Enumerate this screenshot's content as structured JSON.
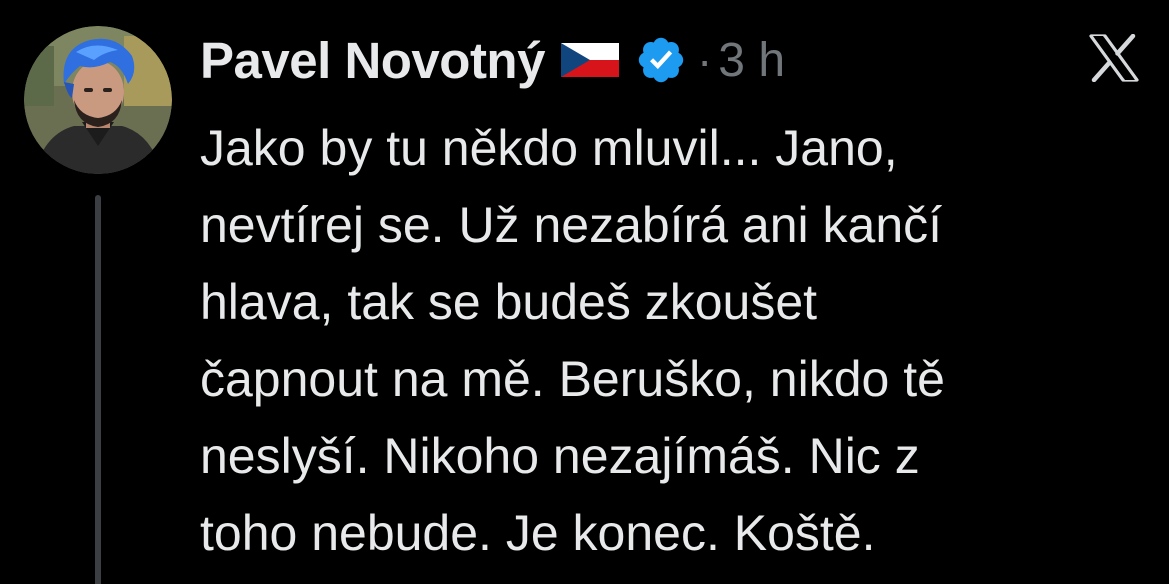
{
  "tweet": {
    "author": {
      "display_name": "Pavel Novotný",
      "flag_icon": "czech-flag-icon",
      "verified_icon": "verified-badge-icon",
      "verified_color": "#1d9bf0"
    },
    "separator": "·",
    "time": "3 h",
    "platform_icon": "x-logo-icon",
    "text_lines": [
      "Jako by tu někdo mluvil... Jano,",
      "nevtírej se. Už nezabírá ani kančí",
      "hlava, tak se budeš zkoušet",
      "čapnout na mě. Beruško, nikdo tě",
      "neslyší. Nikoho nezajímáš. Nic z",
      "toho nebude. Je konec. Koště."
    ]
  },
  "colors": {
    "background": "#000000",
    "text": "#e7e9ea",
    "secondary_text": "#71767b",
    "thread_line": "#3b3f44"
  }
}
